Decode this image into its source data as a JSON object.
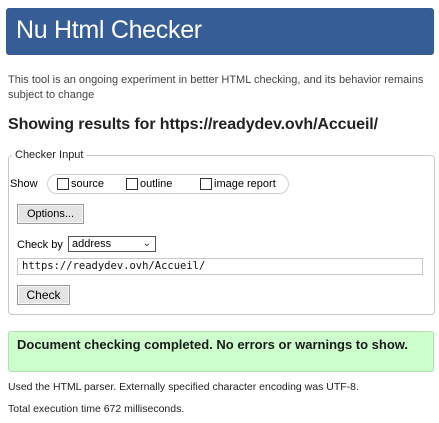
{
  "title": "Nu Html Checker",
  "intro": "This tool is an ongoing experiment in better HTML checking, and its behavior remains subject to change",
  "results_heading": "Showing results for https://readydev.ovh/Accueil/",
  "form": {
    "legend": "Checker Input",
    "show_label": "Show",
    "options": [
      {
        "label": "source",
        "checked": false
      },
      {
        "label": "outline",
        "checked": false
      },
      {
        "label": "image report",
        "checked": false
      }
    ],
    "options_button": "Options...",
    "check_by_label": "Check by",
    "check_by_value": "address",
    "url_value": "https://readydev.ovh/Accueil/",
    "check_button": "Check"
  },
  "result": {
    "message": "Document checking completed. No errors or warnings to show.",
    "color": "#ccffcc"
  },
  "info": {
    "parser": "Used the HTML parser. Externally specified character encoding was UTF-8.",
    "time": "Total execution time 672 milliseconds."
  },
  "colors": {
    "title_bar": "#365d95"
  }
}
